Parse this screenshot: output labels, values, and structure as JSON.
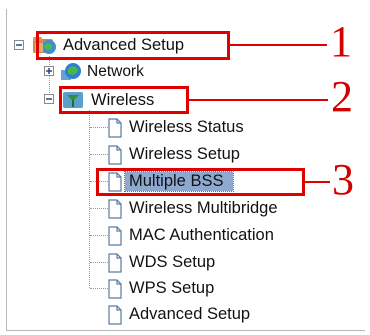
{
  "tree": {
    "root": {
      "label": "Advanced Setup",
      "icon": "globe-folder-icon",
      "expanded": true
    },
    "network": {
      "label": "Network",
      "icon": "globe-icon",
      "expanded": false
    },
    "wireless": {
      "label": "Wireless",
      "icon": "wireless-antenna-icon",
      "expanded": true
    },
    "wireless_items": [
      {
        "label": "Wireless Status",
        "icon": "document-icon"
      },
      {
        "label": "Wireless Setup",
        "icon": "document-icon"
      },
      {
        "label": "Multiple BSS",
        "icon": "document-icon",
        "selected": true
      },
      {
        "label": "Wireless Multibridge",
        "icon": "document-icon"
      },
      {
        "label": "MAC Authentication",
        "icon": "document-icon"
      },
      {
        "label": "WDS Setup",
        "icon": "document-icon"
      },
      {
        "label": "WPS Setup",
        "icon": "document-icon"
      },
      {
        "label": "Advanced Setup",
        "icon": "document-icon"
      }
    ]
  },
  "callouts": {
    "one": "1",
    "two": "2",
    "three": "3"
  },
  "colors": {
    "callout": "#e00000",
    "selection": "#8ea9d0"
  }
}
